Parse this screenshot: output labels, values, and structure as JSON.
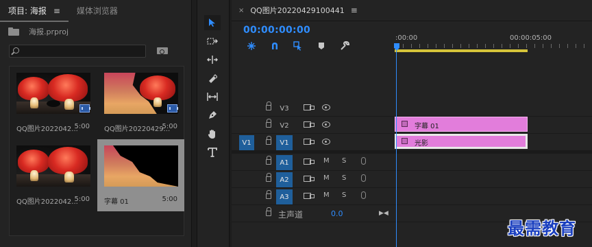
{
  "project_panel": {
    "tab_project": "项目: 海报",
    "tab_menu": "≡",
    "tab_media_browser": "媒体浏览器",
    "project_file": "海报.prproj",
    "search_placeholder": "",
    "items": [
      {
        "name": "QQ图片2022042...",
        "duration": "5:00",
        "kind": "mushroom-photo"
      },
      {
        "name": "QQ图片20220429...",
        "duration": "5:00",
        "kind": "mushroom-graphic"
      },
      {
        "name": "QQ图片2022042...",
        "duration": "5:00",
        "kind": "mushroom-photo"
      },
      {
        "name": "字幕 01",
        "duration": "5:00",
        "kind": "title",
        "selected": true
      }
    ]
  },
  "tools": [
    "selection-tool",
    "track-select-tool",
    "ripple-edit-tool",
    "razor-tool",
    "slip-tool",
    "pen-tool",
    "hand-tool",
    "type-tool"
  ],
  "timeline": {
    "close_glyph": "×",
    "sequence_name": "QQ图片20220429100441",
    "menu_glyph": "≡",
    "timecode": "00:00:00:00",
    "ruler_start": ":00:00",
    "ruler_mark": "00:00:05:00",
    "tracks": {
      "v3": "V3",
      "v2": "V2",
      "v1": "V1",
      "v1_source": "V1",
      "a1": "A1",
      "a2": "A2",
      "a3": "A3",
      "mute_label": "M",
      "solo_label": "S",
      "master_name": "主声道",
      "master_value": "0.0"
    },
    "clips": {
      "v2_clip": "字幕 01",
      "v1_clip": "光影"
    },
    "colors": {
      "accent": "#2f8dff",
      "clip": "#e27ddb",
      "work_area": "#d6c43a",
      "targeted_track": "#1f5f9b"
    }
  },
  "watermark": "最需教育"
}
